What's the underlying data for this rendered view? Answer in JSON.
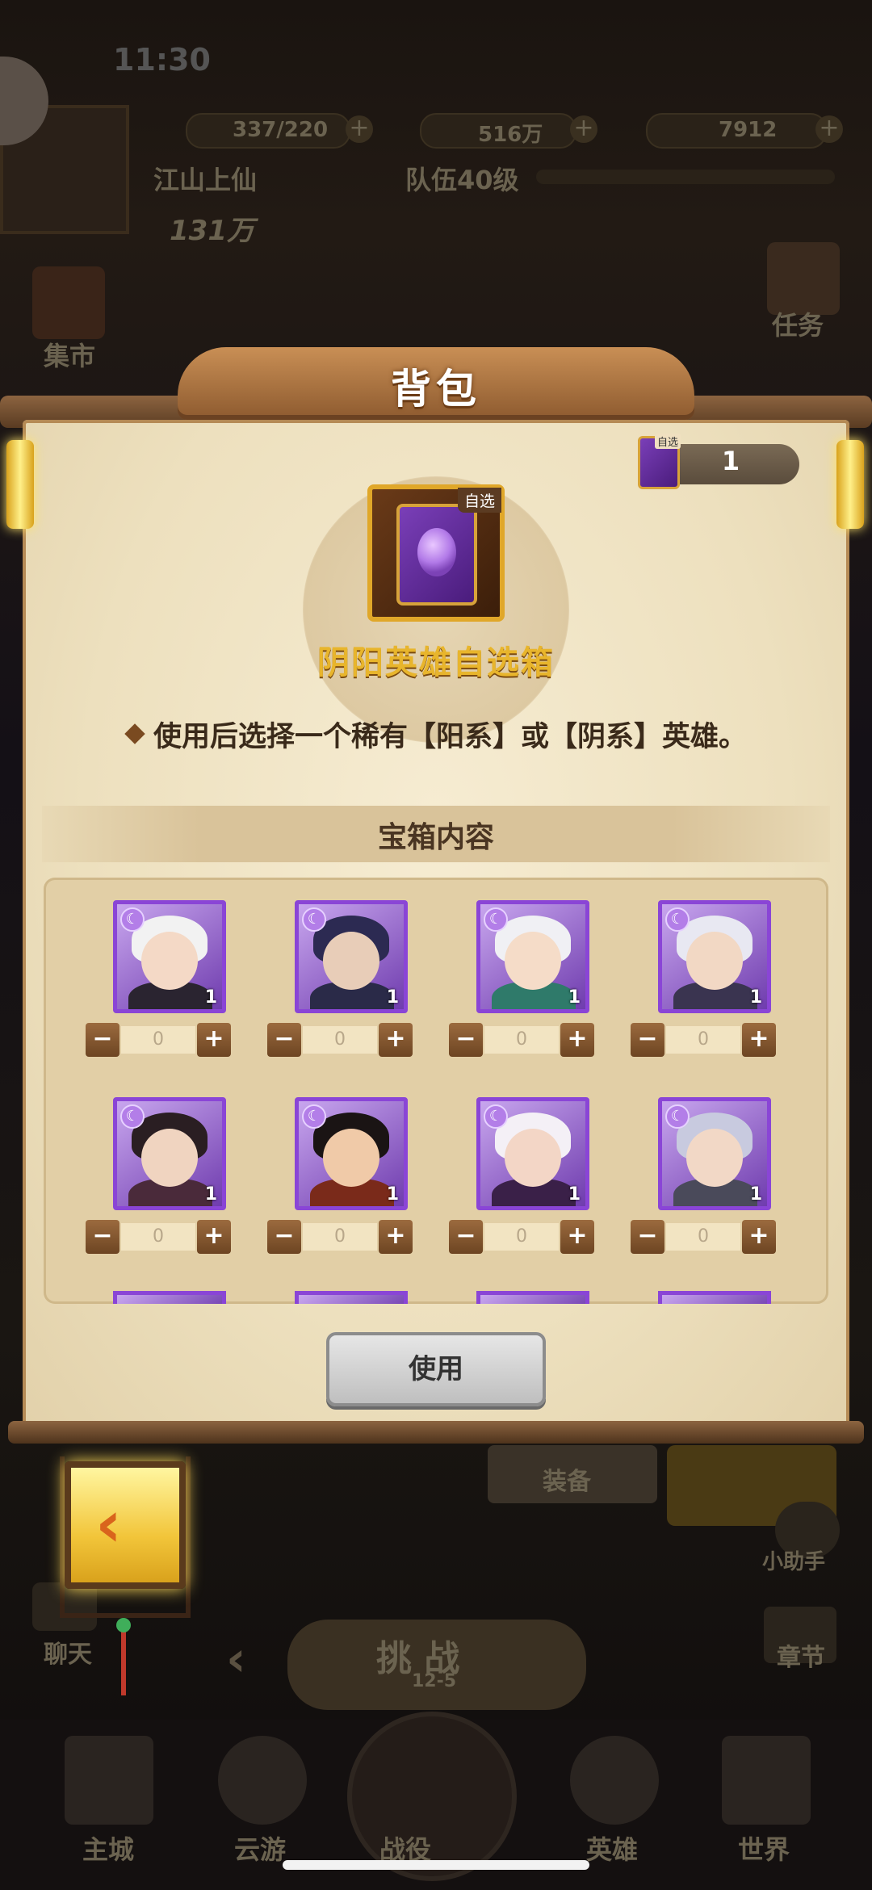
{
  "status_bar": {
    "time": "11:30"
  },
  "top_bar": {
    "stamina": "337/220",
    "gold": "516万",
    "gems": "7912",
    "player_name": "江山上仙",
    "team_level": "队伍40级",
    "power": "131万"
  },
  "side_buttons": {
    "market": "集市",
    "tasks": "任务",
    "assistant": "小助手",
    "chat": "聊天",
    "chapter": "章节"
  },
  "behind_panel": {
    "equip": "装备",
    "challenge": "挑 战",
    "stage": "12-5"
  },
  "bag": {
    "title": "背包",
    "owned_count": "1",
    "owned_tag": "自选",
    "item": {
      "name": "阴阳英雄自选箱",
      "tag": "自选",
      "description": "使用后选择一个稀有【阳系】或【阴系】英雄。"
    },
    "section_title": "宝箱内容",
    "heroes": [
      {
        "level": "1",
        "qty": "0",
        "minus": "−",
        "plus": "+",
        "palette": "white-hair-red-eyes"
      },
      {
        "level": "1",
        "qty": "0",
        "minus": "−",
        "plus": "+",
        "palette": "hooded-dark"
      },
      {
        "level": "1",
        "qty": "0",
        "minus": "−",
        "plus": "+",
        "palette": "white-hair-green"
      },
      {
        "level": "1",
        "qty": "0",
        "minus": "−",
        "plus": "+",
        "palette": "white-hair-armored"
      },
      {
        "level": "1",
        "qty": "0",
        "minus": "−",
        "plus": "+",
        "palette": "dark-hair-robe"
      },
      {
        "level": "1",
        "qty": "0",
        "minus": "−",
        "plus": "+",
        "palette": "bearded-general"
      },
      {
        "level": "1",
        "qty": "0",
        "minus": "−",
        "plus": "+",
        "palette": "white-hair-mask"
      },
      {
        "level": "1",
        "qty": "0",
        "minus": "−",
        "plus": "+",
        "palette": "silver-helmet"
      }
    ],
    "use_button": "使用"
  },
  "bottom_nav": [
    "主城",
    "云游",
    "战役",
    "英雄",
    "世界"
  ],
  "colors": {
    "accent_gold": "#e8b52c",
    "hero_frame_purple": "#8a45d6",
    "paper": "#f0e4c6"
  }
}
